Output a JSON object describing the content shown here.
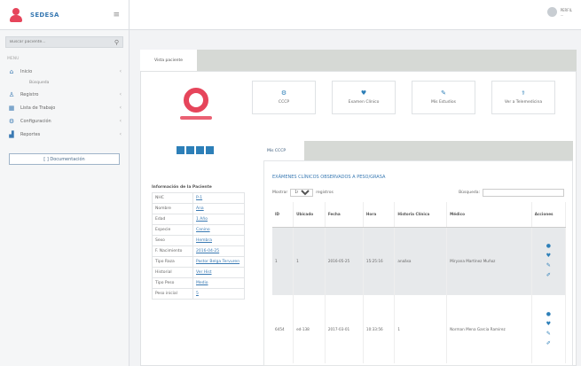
{
  "brand": {
    "name": "SEDESA",
    "menu_toggle": "≡"
  },
  "topbar": {
    "user_name": "PERFIL",
    "user_role": "..."
  },
  "sidebar": {
    "search_placeholder": "Buscar paciente...",
    "search_icon": "search-icon",
    "menu_header": "MENU",
    "items": [
      {
        "label": "Inicio",
        "icon": "home-icon",
        "glyph": "⌂"
      },
      {
        "label": "Registro",
        "icon": "user-icon",
        "glyph": "♙"
      },
      {
        "label": "Lista de Trabajo",
        "icon": "calendar-icon",
        "glyph": "▦"
      },
      {
        "label": "Configuración",
        "icon": "gear-icon",
        "glyph": "⚙"
      },
      {
        "label": "Reportes",
        "icon": "chart-icon",
        "glyph": "▟"
      }
    ],
    "sub_item": "Búsqueda",
    "doc_button": "[ ] Documentación"
  },
  "outer_tab": "Vista paciente",
  "cards": [
    {
      "label": "CCCP",
      "icon": "gear-icon",
      "glyph": "⚙"
    },
    {
      "label": "Examen Clínico",
      "icon": "heart-icon",
      "glyph": "♥"
    },
    {
      "label": "Mis Estudios",
      "icon": "pencil-icon",
      "glyph": "✎"
    },
    {
      "label": "Ver a Telemedicina",
      "icon": "stethoscope-icon",
      "glyph": "⚕"
    }
  ],
  "profile": {
    "info_title": "Información de la Paciente",
    "fields": [
      {
        "key": "NHC",
        "value": "P-1"
      },
      {
        "key": "Nombre",
        "value": "Ana"
      },
      {
        "key": "Edad",
        "value": "1 Año"
      },
      {
        "key": "Especie",
        "value": "Canino"
      },
      {
        "key": "Sexo",
        "value": "Hembra"
      },
      {
        "key": "F. Nacimiento",
        "value": "2016-04-25"
      },
      {
        "key": "Tipo Raza",
        "value": "Pastor Belga Tervuren"
      },
      {
        "key": "Historial",
        "value": "Ver Hist"
      },
      {
        "key": "Tipo Peso",
        "value": "Medio"
      },
      {
        "key": "Peso inicial",
        "value": "5"
      }
    ]
  },
  "inner_tab": "Mis CCCP",
  "section": {
    "title": "EXÁMENES CLÍNICOS OBSERVADOS A PESO/GRASA",
    "show_label": "Mostrar",
    "show_value": "10",
    "show_suffix": "registros",
    "search_label": "Búsqueda:"
  },
  "table": {
    "headers": [
      "ID",
      "Ubicado",
      "Fecha",
      "Hora",
      "Historia Clínica",
      "Médico",
      "Acciones"
    ],
    "rows": [
      [
        "1",
        "1",
        "2016-05-25",
        "15:25:16",
        "anaãsa",
        "Miryana Martínez Muñoz"
      ],
      [
        "6454",
        "ed-138",
        "2017-03-01",
        "10:33:56",
        "1",
        "Norman Mena Garcia Ramirez"
      ]
    ],
    "action_icons": [
      "eye-icon",
      "heart-icon",
      "edit-icon",
      "pencil-icon"
    ]
  }
}
